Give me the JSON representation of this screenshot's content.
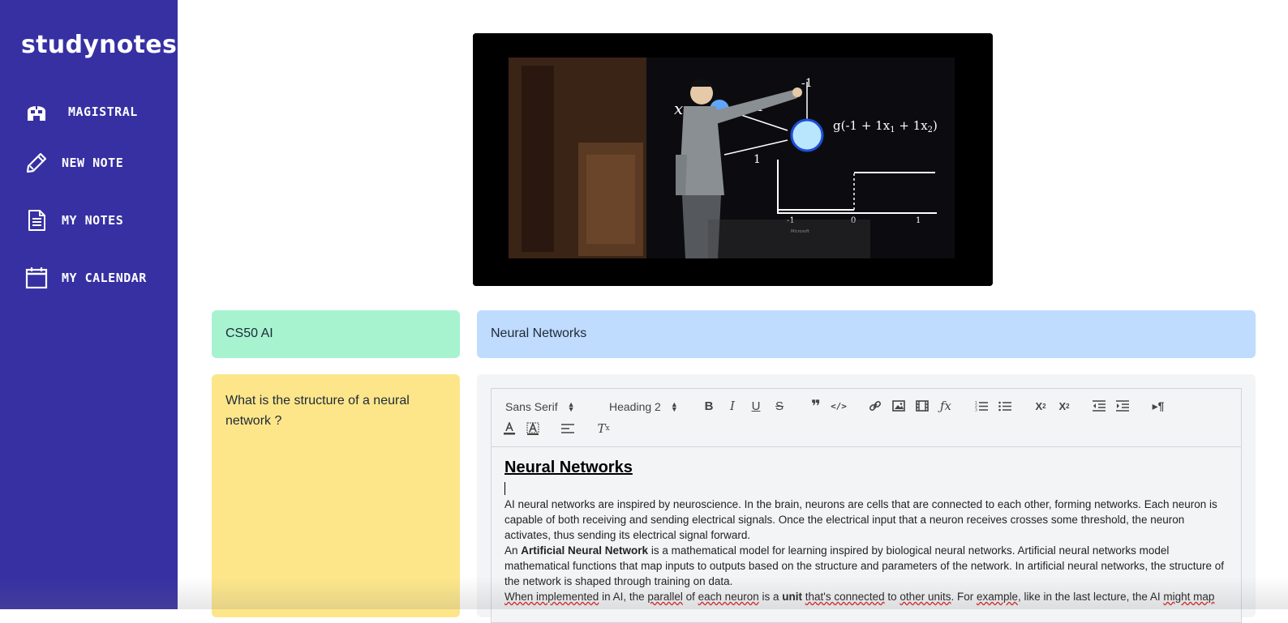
{
  "sidebar": {
    "brand": "studynotes",
    "items": [
      {
        "label": "MAGISTRAL",
        "icon": "helmet-icon"
      },
      {
        "label": "NEW NOTE",
        "icon": "pencil-icon"
      },
      {
        "label": "MY NOTES",
        "icon": "document-icon"
      },
      {
        "label": "MY CALENDAR",
        "icon": "calendar-icon"
      }
    ]
  },
  "video": {
    "x1_label": "x",
    "x1_sub": "1",
    "weight_top": "-1",
    "weight_1a": "1",
    "weight_1b": "1",
    "formula": "g(-1 + 1x",
    "formula_sub1": "1",
    "formula_mid": " + 1x",
    "formula_sub2": "2",
    "formula_end": ")",
    "axis_neg1": "-1",
    "axis_0": "0",
    "axis_1": "1",
    "watermark": "Microsoft"
  },
  "note": {
    "course": "CS50 AI",
    "topic": "Neural Networks",
    "question": "What is the structure of a neural network ?"
  },
  "editor": {
    "font_picker": "Sans Serif",
    "header_picker": "Heading 2",
    "heading": "Neural Networks",
    "p1": "AI neural networks are inspired by neuroscience. In the brain, neurons are cells that are connected to each other, forming networks. Each neuron is capable of both receiving and sending electrical signals. Once the electrical input that a neuron receives crosses some threshold, the neuron activates, thus sending its electrical signal forward.",
    "p2_a": "An ",
    "p2_bold": "Artificial Neural Network",
    "p2_b": " is a mathematical model for learning inspired by biological neural networks. Artificial neural networks model mathematical functions that map inputs to outputs based on the structure and parameters of the network. In artificial neural networks, the structure of the network is shaped through training on data.",
    "p3": {
      "w1": "When implemented",
      "w2": " in AI, the ",
      "w3": "parallel",
      "w4": " of ",
      "w5": "each neuron",
      "w6": " is a ",
      "w7": "unit",
      "w8": " ",
      "w9": "that's connected",
      "w10": " to ",
      "w11": "other units",
      "w12": ". For ",
      "w13": "example",
      "w14": ", like in the last lecture, the AI ",
      "w15": "might map"
    }
  }
}
